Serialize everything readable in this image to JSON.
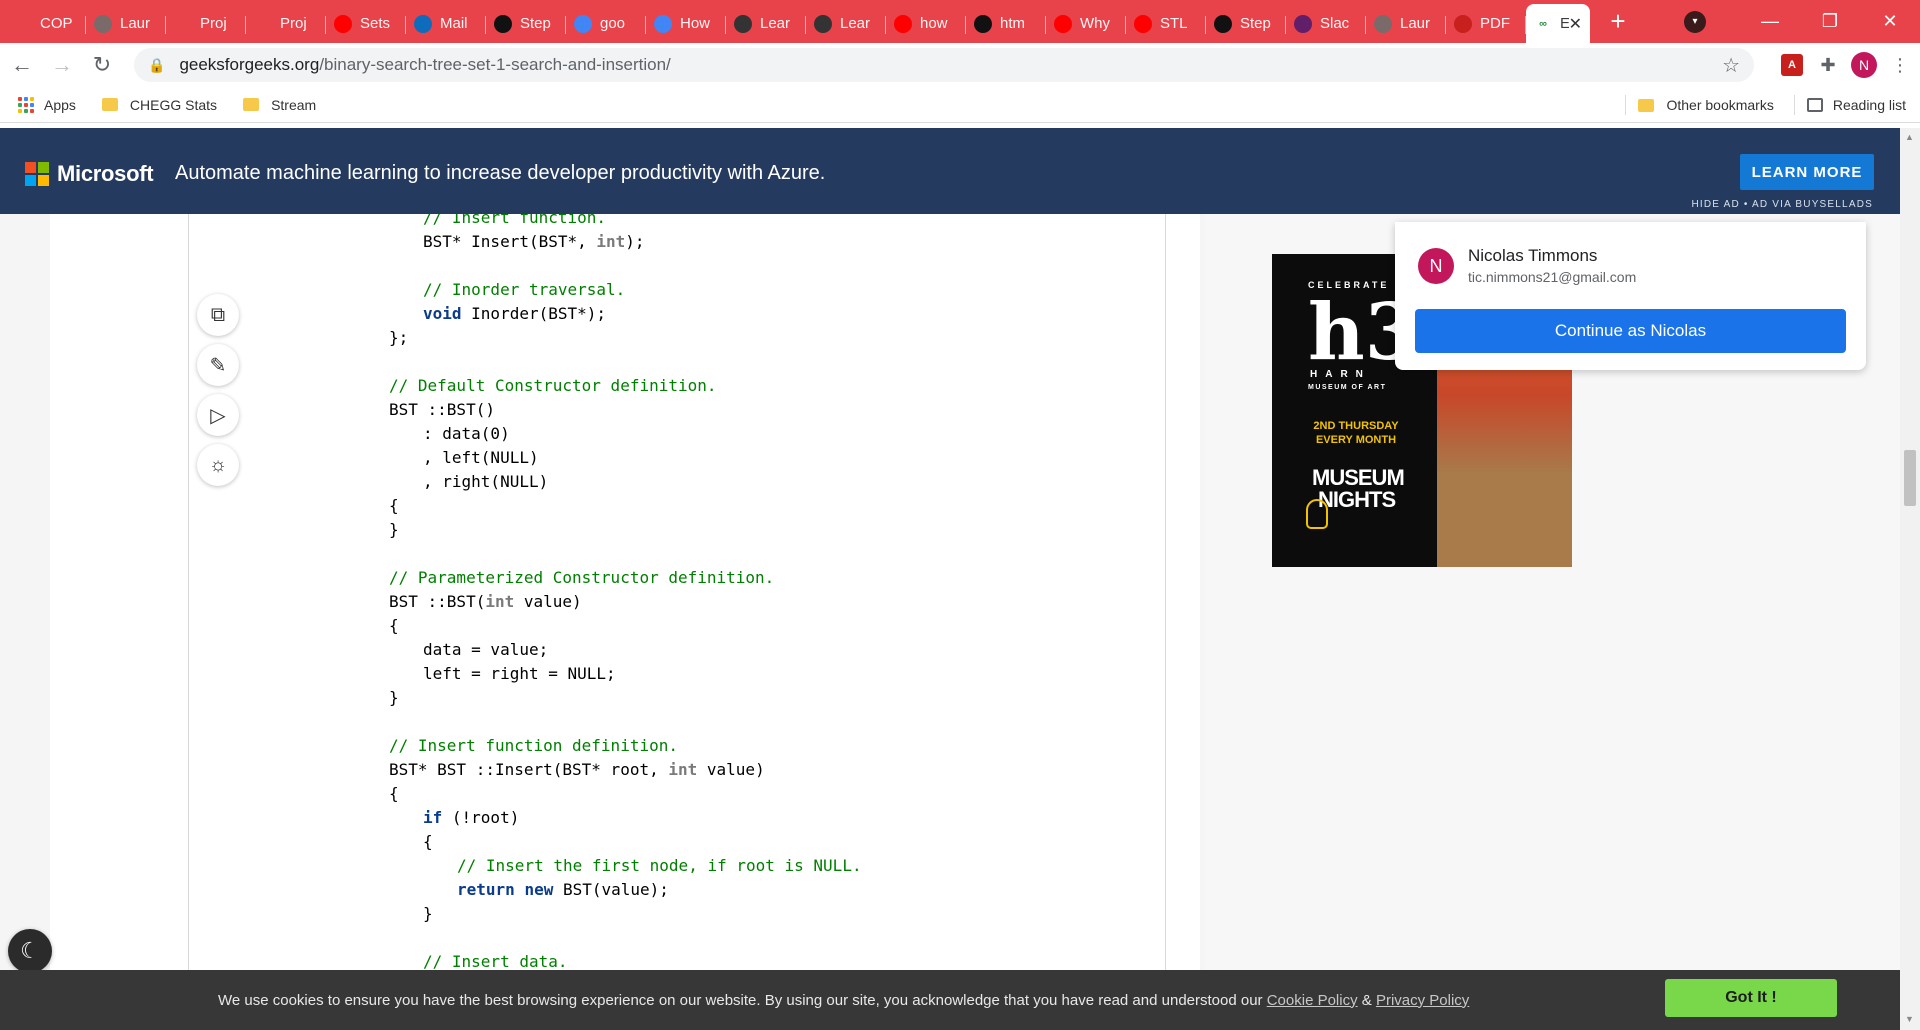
{
  "browser": {
    "tabs": [
      {
        "title": "COP",
        "color": "#e8424a",
        "icon": "circle-icon"
      },
      {
        "title": "Laur",
        "color": "#7a6a6a",
        "icon": "globe-icon"
      },
      {
        "title": "Proj",
        "color": "#e8424a",
        "icon": "circle-icon"
      },
      {
        "title": "Proj",
        "color": "#e8424a",
        "icon": "circle-icon"
      },
      {
        "title": "Sets",
        "color": "#ff0000",
        "icon": "youtube-icon"
      },
      {
        "title": "Mail",
        "color": "#0f6cbd",
        "icon": "outlook-icon"
      },
      {
        "title": "Step",
        "color": "#111111",
        "icon": "stepik-icon"
      },
      {
        "title": "goo",
        "color": "#4285f4",
        "icon": "google-icon"
      },
      {
        "title": "How",
        "color": "#4285f4",
        "icon": "google-icon"
      },
      {
        "title": "Lear",
        "color": "#333333",
        "icon": "book-icon"
      },
      {
        "title": "Lear",
        "color": "#333333",
        "icon": "book-icon"
      },
      {
        "title": "how",
        "color": "#ff0000",
        "icon": "youtube-icon"
      },
      {
        "title": "htm",
        "color": "#111111",
        "icon": "github-icon"
      },
      {
        "title": "Why",
        "color": "#ff0000",
        "icon": "youtube-icon"
      },
      {
        "title": "STL",
        "color": "#ff0000",
        "icon": "youtube-icon"
      },
      {
        "title": "Step",
        "color": "#111111",
        "icon": "stepik-icon"
      },
      {
        "title": "Slac",
        "color": "#611f69",
        "icon": "slack-icon"
      },
      {
        "title": "Laur",
        "color": "#7a6a6a",
        "icon": "globe-icon"
      },
      {
        "title": "PDF",
        "color": "#c7201d",
        "icon": "pdf-icon"
      }
    ],
    "active_tab": {
      "title": "E",
      "icon": "geeksforgeeks-icon"
    },
    "new_tab": "+",
    "url_host": "geeksforgeeks.org",
    "url_path": "/binary-search-tree-set-1-search-and-insertion/",
    "profile_initial": "N",
    "bookmarks": [
      {
        "label": "Apps",
        "icon": "apps-grid-icon"
      },
      {
        "label": "CHEGG Stats",
        "icon": "folder-icon"
      },
      {
        "label": "Stream",
        "icon": "folder-icon"
      }
    ],
    "bookmarks_right": {
      "other": "Other bookmarks",
      "reading": "Reading list"
    }
  },
  "ad_banner": {
    "brand": "Microsoft",
    "text": "Automate machine learning to increase developer productivity with Azure.",
    "button": "LEARN MORE",
    "hide_ad": "HIDE AD • AD VIA BUYSELLADS",
    "colors": {
      "background": "#243a5e",
      "button": "#1479d4"
    }
  },
  "code_lines": [
    {
      "indent": 1,
      "parts": [
        {
          "t": "// Insert function.",
          "c": "cm"
        }
      ]
    },
    {
      "indent": 1,
      "parts": [
        {
          "t": "BST* Insert(BST*, ",
          "c": "nm"
        },
        {
          "t": "int",
          "c": "ty"
        },
        {
          "t": ");",
          "c": "nm"
        }
      ]
    },
    {
      "indent": 0,
      "parts": []
    },
    {
      "indent": 1,
      "parts": [
        {
          "t": "// Inorder traversal.",
          "c": "cm"
        }
      ]
    },
    {
      "indent": 1,
      "parts": [
        {
          "t": "void",
          "c": "kw"
        },
        {
          "t": " Inorder(BST*);",
          "c": "nm"
        }
      ]
    },
    {
      "indent": 0,
      "parts": [
        {
          "t": "};",
          "c": "nm"
        }
      ]
    },
    {
      "indent": 0,
      "parts": []
    },
    {
      "indent": 0,
      "parts": [
        {
          "t": "// Default Constructor definition.",
          "c": "cm"
        }
      ]
    },
    {
      "indent": 0,
      "parts": [
        {
          "t": "BST ::BST()",
          "c": "nm"
        }
      ]
    },
    {
      "indent": 1,
      "parts": [
        {
          "t": ": data(0)",
          "c": "nm"
        }
      ]
    },
    {
      "indent": 1,
      "parts": [
        {
          "t": ", left(NULL)",
          "c": "nm"
        }
      ]
    },
    {
      "indent": 1,
      "parts": [
        {
          "t": ", right(NULL)",
          "c": "nm"
        }
      ]
    },
    {
      "indent": 0,
      "parts": [
        {
          "t": "{",
          "c": "nm"
        }
      ]
    },
    {
      "indent": 0,
      "parts": [
        {
          "t": "}",
          "c": "nm"
        }
      ]
    },
    {
      "indent": 0,
      "parts": []
    },
    {
      "indent": 0,
      "parts": [
        {
          "t": "// Parameterized Constructor definition.",
          "c": "cm"
        }
      ]
    },
    {
      "indent": 0,
      "parts": [
        {
          "t": "BST ::BST(",
          "c": "nm"
        },
        {
          "t": "int",
          "c": "ty"
        },
        {
          "t": " value)",
          "c": "nm"
        }
      ]
    },
    {
      "indent": 0,
      "parts": [
        {
          "t": "{",
          "c": "nm"
        }
      ]
    },
    {
      "indent": 1,
      "parts": [
        {
          "t": "data = value;",
          "c": "nm"
        }
      ]
    },
    {
      "indent": 1,
      "parts": [
        {
          "t": "left = right = NULL;",
          "c": "nm"
        }
      ]
    },
    {
      "indent": 0,
      "parts": [
        {
          "t": "}",
          "c": "nm"
        }
      ]
    },
    {
      "indent": 0,
      "parts": []
    },
    {
      "indent": 0,
      "parts": [
        {
          "t": "// Insert function definition.",
          "c": "cm"
        }
      ]
    },
    {
      "indent": 0,
      "parts": [
        {
          "t": "BST* BST ::Insert(BST* root, ",
          "c": "nm"
        },
        {
          "t": "int",
          "c": "ty"
        },
        {
          "t": " value)",
          "c": "nm"
        }
      ]
    },
    {
      "indent": 0,
      "parts": [
        {
          "t": "{",
          "c": "nm"
        }
      ]
    },
    {
      "indent": 1,
      "parts": [
        {
          "t": "if",
          "c": "kw"
        },
        {
          "t": " (!root)",
          "c": "nm"
        }
      ]
    },
    {
      "indent": 1,
      "parts": [
        {
          "t": "{",
          "c": "nm"
        }
      ]
    },
    {
      "indent": 2,
      "parts": [
        {
          "t": "// Insert the first node, if root is NULL.",
          "c": "cm"
        }
      ]
    },
    {
      "indent": 2,
      "parts": [
        {
          "t": "return",
          "c": "kw"
        },
        {
          "t": " ",
          "c": "nm"
        },
        {
          "t": "new",
          "c": "kw"
        },
        {
          "t": " BST(value);",
          "c": "nm"
        }
      ]
    },
    {
      "indent": 1,
      "parts": [
        {
          "t": "}",
          "c": "nm"
        }
      ]
    },
    {
      "indent": 0,
      "parts": []
    },
    {
      "indent": 1,
      "parts": [
        {
          "t": "// Insert data.",
          "c": "cm"
        }
      ]
    }
  ],
  "code_tools": [
    {
      "name": "copy-icon",
      "glyph": "⧉"
    },
    {
      "name": "edit-icon",
      "glyph": "✎"
    },
    {
      "name": "run-icon",
      "glyph": "▷"
    },
    {
      "name": "theme-icon",
      "glyph": "☼"
    }
  ],
  "dark_mode_glyph": "☾",
  "side_ad": {
    "celebrate": "CELEBRATE",
    "big": "h3",
    "name": "HARN",
    "sub": "MUSEUM OF ART",
    "thursday_1": "2ND THURSDAY",
    "thursday_2": "EVERY MONTH",
    "museum": "MUSEUM",
    "nights": "NIGHTS"
  },
  "signin": {
    "initial": "N",
    "name": "Nicolas Timmons",
    "email": "tic.nimmons21@gmail.com",
    "button": "Continue as Nicolas"
  },
  "cookie": {
    "text": "We use cookies to ensure you have the best browsing experience on our website. By using our site, you acknowledge that you have read and understood our ",
    "cookie_policy": "Cookie Policy",
    "amp": " & ",
    "privacy_policy": "Privacy Policy",
    "button": "Got It !"
  }
}
